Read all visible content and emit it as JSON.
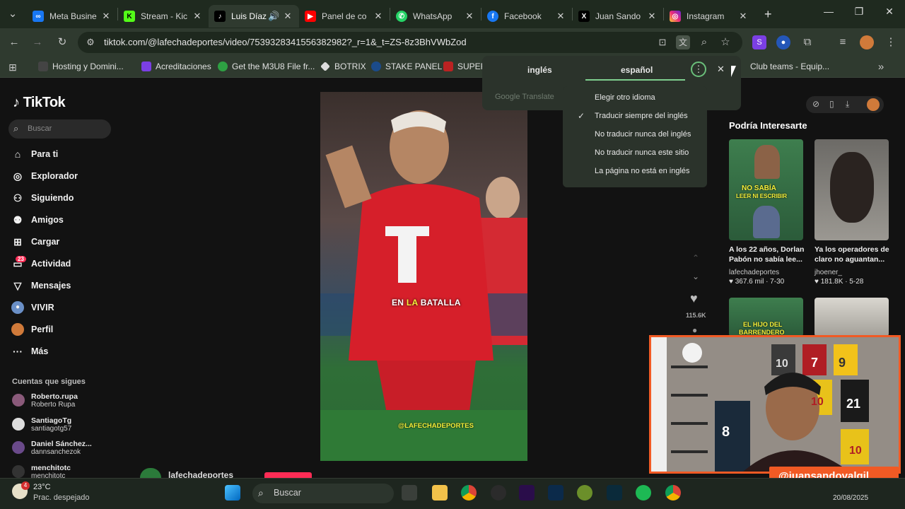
{
  "browser": {
    "tabs": [
      {
        "title": "Meta Busine",
        "favicon": "meta-icon"
      },
      {
        "title": "Stream - Kic",
        "favicon": "kick-icon"
      },
      {
        "title": "Luis Díaz",
        "favicon": "tiktok-icon",
        "active": true
      },
      {
        "title": "Panel de co",
        "favicon": "youtube-icon"
      },
      {
        "title": "WhatsApp",
        "favicon": "whatsapp-icon"
      },
      {
        "title": "Facebook",
        "favicon": "facebook-icon"
      },
      {
        "title": "Juan Sando",
        "favicon": "x-icon"
      },
      {
        "title": "Instagram",
        "favicon": "instagram-icon"
      }
    ],
    "new_tab": "+",
    "url": "tiktok.com/@lafechadeportes/video/7539328341556382982?_r=1&_t=ZS-8z3BhVWbZod",
    "bookmarks": [
      "Hosting y Domini...",
      "Acreditaciones",
      "Get the M3U8 File fr...",
      "BOTRIX",
      "STAKE PANEL",
      "SUPER",
      "Club teams - Equip..."
    ]
  },
  "translate": {
    "source_lang": "inglés",
    "target_lang": "español",
    "brand": "Google Translate",
    "menu": [
      {
        "label": "Elegir otro idioma",
        "checked": false
      },
      {
        "label": "Traducir siempre del inglés",
        "checked": true
      },
      {
        "label": "No traducir nunca del inglés",
        "checked": false
      },
      {
        "label": "No traducir nunca este sitio",
        "checked": false
      },
      {
        "label": "La página no está en inglés",
        "checked": false
      }
    ]
  },
  "tiktok": {
    "logo": "TikTok",
    "search_placeholder": "Buscar",
    "nav": [
      {
        "label": "Para ti",
        "icon": "home-icon"
      },
      {
        "label": "Explorador",
        "icon": "compass-icon"
      },
      {
        "label": "Siguiendo",
        "icon": "following-icon"
      },
      {
        "label": "Amigos",
        "icon": "friends-icon"
      },
      {
        "label": "Cargar",
        "icon": "upload-icon"
      },
      {
        "label": "Actividad",
        "icon": "activity-icon",
        "badge": "23"
      },
      {
        "label": "Mensajes",
        "icon": "messages-icon"
      },
      {
        "label": "VIVIR",
        "icon": "live-icon"
      },
      {
        "label": "Perfil",
        "icon": "profile-icon"
      },
      {
        "label": "Más",
        "icon": "more-icon"
      }
    ],
    "following_header": "Cuentas que sigues",
    "following": [
      {
        "name": "Roberto.rupa",
        "sub": "Roberto Rupa"
      },
      {
        "name": "SantiagoTg",
        "sub": "santiagotg57"
      },
      {
        "name": "Daniel Sánchez...",
        "sub": "dannsanchezok"
      },
      {
        "name": "menchitotc",
        "sub": "menchitotc"
      }
    ],
    "video": {
      "overlay_pre": "EN ",
      "overlay_hl": "LA",
      "overlay_post": " BATALLA",
      "watermark": "@LAFECHADEPORTES",
      "likes": "115.6K",
      "author": "lafechadeportes"
    },
    "recommended_title": "Podría Interesarte",
    "recommended": [
      {
        "caption": "A los 22 años, Dorlan Pabón no sabía lee...",
        "author": "lafechadeportes",
        "stats": "367.6 mil · 7-30",
        "thumb_text1": "NO SABÍA",
        "thumb_text2": "LEER NI ESCRIBIR"
      },
      {
        "caption": "Ya los operadores de claro no aguantan...",
        "author": "jhoener_",
        "stats": "181.8K · 5-28"
      },
      {
        "thumb_text1": "EL HIJO DEL",
        "thumb_text2": "BARRENDERO"
      },
      {}
    ]
  },
  "webcam": {
    "handle": "@juansandovalgil",
    "jersey_numbers": [
      "10",
      "7",
      "9",
      "10",
      "21",
      "10",
      "8"
    ]
  },
  "taskbar": {
    "weather_temp": "23°C",
    "weather_desc": "Prac. despejado",
    "weather_badge": "4",
    "search": "Buscar",
    "date": "20/08/2025"
  },
  "colors": {
    "accent": "#7fcf8f",
    "webcam_frame": "#f15a24",
    "tiktok_bg": "#121212",
    "browser_bar": "#2f3a2f"
  }
}
